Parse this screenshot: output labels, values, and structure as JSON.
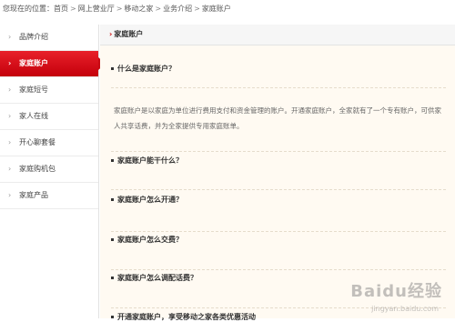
{
  "breadcrumb": {
    "prefix": "您现在的位置：",
    "items": [
      "首页",
      "网上营业厅",
      "移动之家",
      "业务介绍",
      "家庭账户"
    ]
  },
  "sidebar": {
    "items": [
      {
        "label": "品牌介绍",
        "active": false
      },
      {
        "label": "家庭账户",
        "active": true
      },
      {
        "label": "家庭短号",
        "active": false
      },
      {
        "label": "家人在线",
        "active": false
      },
      {
        "label": "开心聊套餐",
        "active": false
      },
      {
        "label": "家庭购机包",
        "active": false
      },
      {
        "label": "家庭产品",
        "active": false
      }
    ]
  },
  "main": {
    "title": "家庭账户",
    "sections": [
      {
        "question": "什么是家庭账户？",
        "answer": "家庭账户是以家庭为单位进行费用支付和资金管理的账户。开通家庭账户，全家就有了一个专有账户，可供家人共享话费，并为全家提供专用家庭账单。"
      },
      {
        "question": "家庭账户能干什么？"
      },
      {
        "question": "家庭账户怎么开通？"
      },
      {
        "question": "家庭账户怎么交费？"
      },
      {
        "question": "家庭账户怎么调配话费？"
      },
      {
        "question": "开通家庭账户，享受移动之家各类优惠活动"
      }
    ]
  },
  "watermark": {
    "text": "Baidu经验",
    "sub": "jingyan.baidu.com"
  },
  "colors": {
    "accent": "#d0121b",
    "content_bg": "#fffaf2"
  }
}
